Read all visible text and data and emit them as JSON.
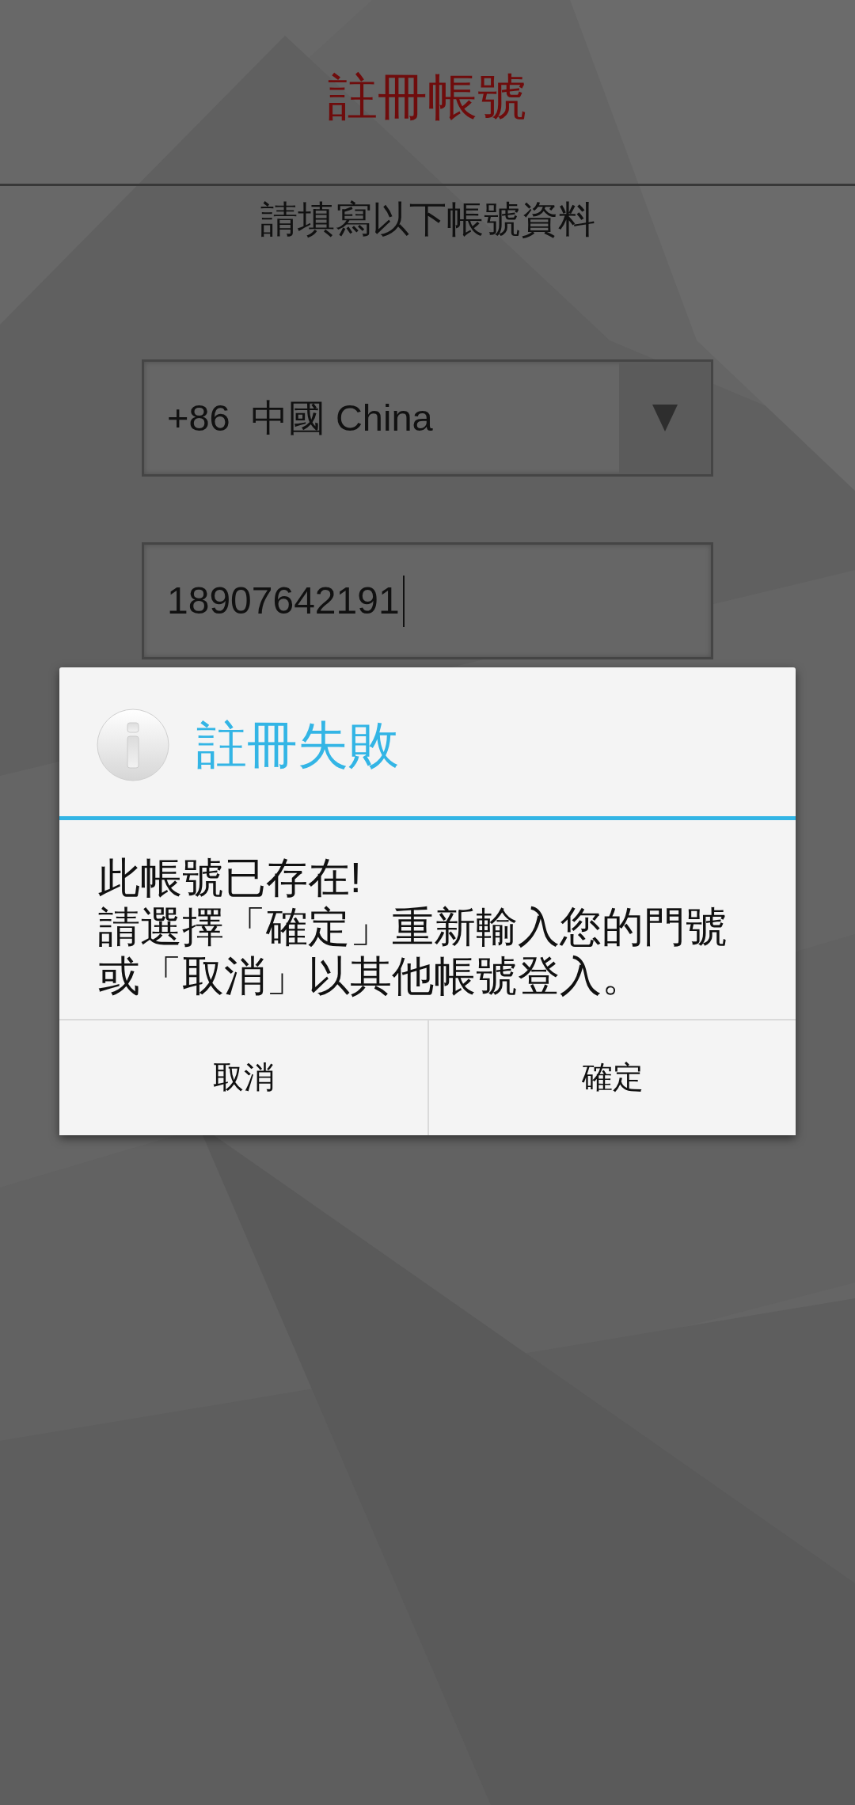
{
  "page": {
    "title": "註冊帳號",
    "subtitle": "請填寫以下帳號資料"
  },
  "form": {
    "country_select": {
      "value": "+86  中國 China"
    },
    "phone_field": {
      "value": "18907642191",
      "focused": true
    }
  },
  "dialog": {
    "title": "註冊失敗",
    "message": [
      "此帳號已存在!",
      "請選擇「確定」重新輸入您的門號或「取消」以其他帳號登入。"
    ],
    "buttons": [
      {
        "label": "取消"
      },
      {
        "label": "確定"
      }
    ]
  }
}
